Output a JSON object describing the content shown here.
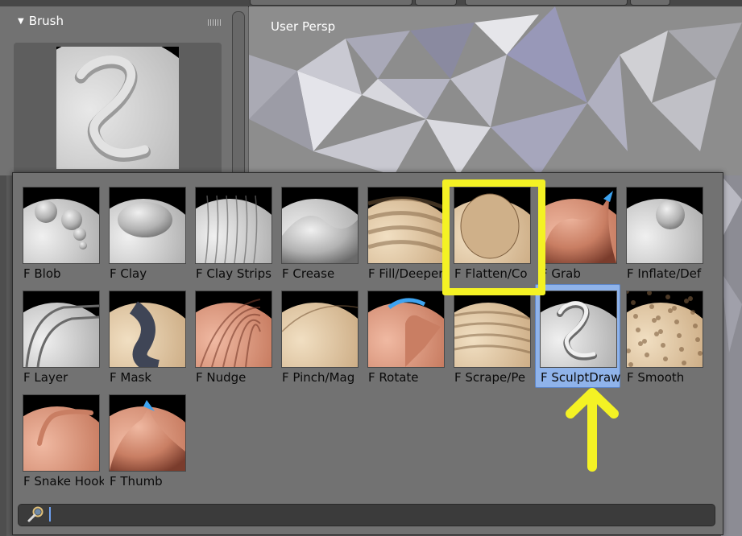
{
  "panel": {
    "title": "Brush",
    "collapse_glyph": "▼"
  },
  "viewport": {
    "label": "User Persp"
  },
  "brushes": [
    {
      "label": "F Blob",
      "key": "blob",
      "shade": "gray"
    },
    {
      "label": "F Clay",
      "key": "clay",
      "shade": "gray"
    },
    {
      "label": "F Clay Strips",
      "key": "clay-strips",
      "shade": "gray"
    },
    {
      "label": "F Crease",
      "key": "crease",
      "shade": "gray"
    },
    {
      "label": "F Fill/Deeper",
      "key": "fill-deepen",
      "shade": "tan"
    },
    {
      "label": "F Flatten/Co",
      "key": "flatten-contrast",
      "shade": "tan"
    },
    {
      "label": "F Grab",
      "key": "grab",
      "shade": "skin"
    },
    {
      "label": "F Inflate/Def",
      "key": "inflate-deflate",
      "shade": "gray"
    },
    {
      "label": "F Layer",
      "key": "layer",
      "shade": "gray"
    },
    {
      "label": "F Mask",
      "key": "mask",
      "shade": "tan"
    },
    {
      "label": "F Nudge",
      "key": "nudge",
      "shade": "skin"
    },
    {
      "label": "F Pinch/Mag",
      "key": "pinch-magnify",
      "shade": "tan"
    },
    {
      "label": "F Rotate",
      "key": "rotate",
      "shade": "skin"
    },
    {
      "label": "F Scrape/Pe",
      "key": "scrape-peaks",
      "shade": "tan"
    },
    {
      "label": "F SculptDraw",
      "key": "sculpt-draw",
      "shade": "gray",
      "selected": true
    },
    {
      "label": "F Smooth",
      "key": "smooth",
      "shade": "tan"
    },
    {
      "label": "F Snake Hook",
      "key": "snake-hook",
      "shade": "skin"
    },
    {
      "label": "F Thumb",
      "key": "thumb",
      "shade": "skin"
    }
  ],
  "search": {
    "value": "",
    "icon": "magnifier-icon"
  },
  "annotations": {
    "highlight_color": "#f4f224",
    "arrow_color": "#f4f224"
  },
  "colors": {
    "selected_bg": "#8fb3ea",
    "popup_bg": "#727272"
  }
}
